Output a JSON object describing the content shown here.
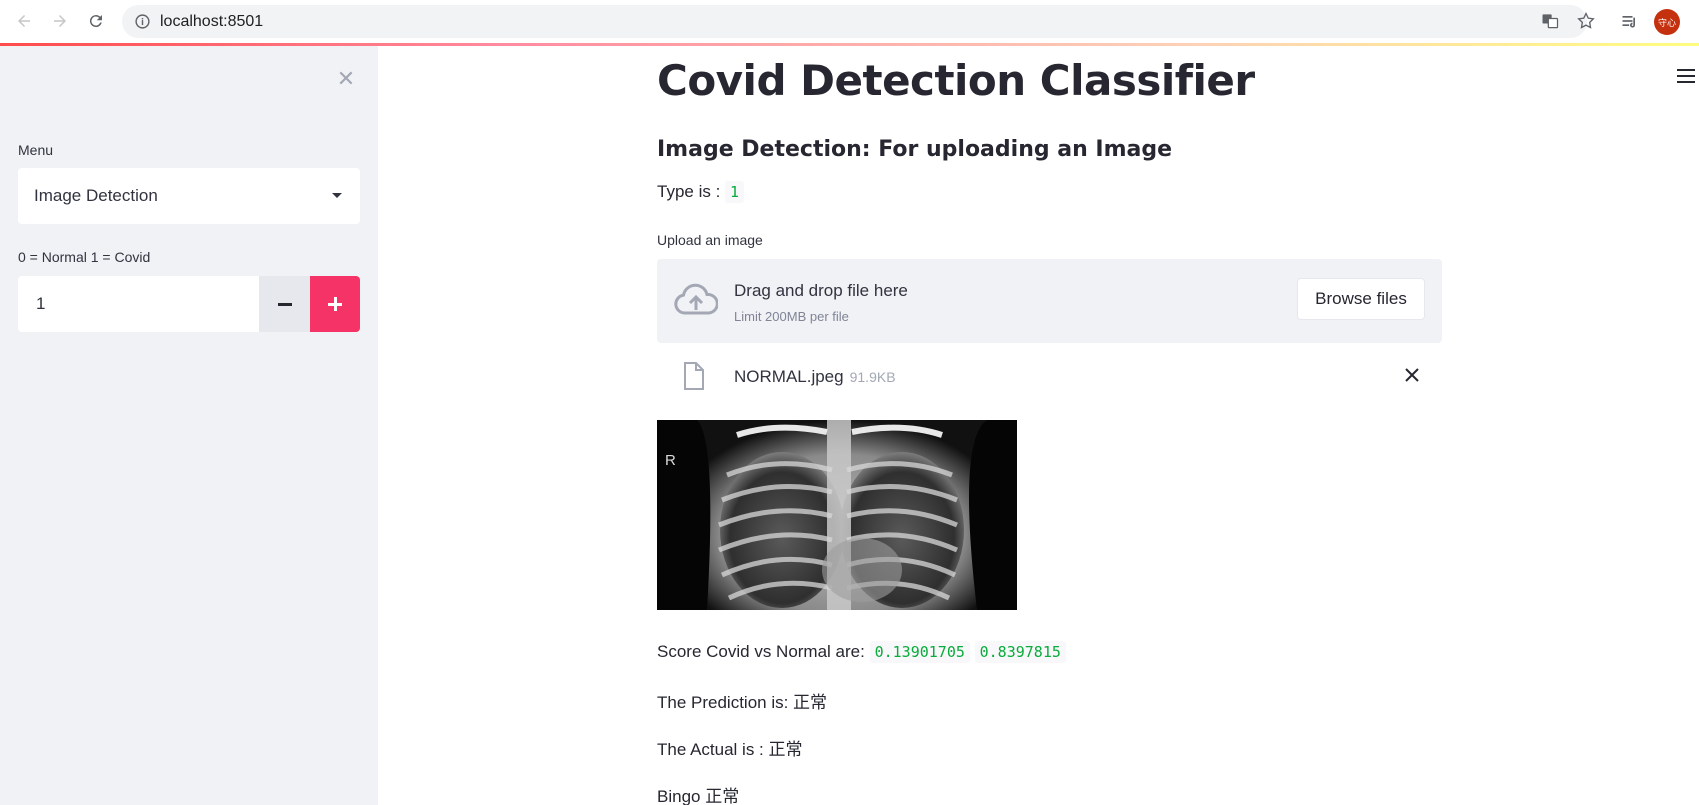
{
  "browser": {
    "url": "localhost:8501",
    "avatar_text": "守心"
  },
  "sidebar": {
    "menu_label": "Menu",
    "menu_selected": "Image Detection",
    "number_label": "0 = Normal 1 = Covid",
    "number_value": "1"
  },
  "main": {
    "title": "Covid Detection Classifier",
    "subheader": "Image Detection: For uploading an Image",
    "type_label": "Type is :",
    "type_value": "1",
    "uploader_label": "Upload an image",
    "dropzone_title": "Drag and drop file here",
    "dropzone_limit": "Limit 200MB per file",
    "browse_label": "Browse files",
    "file_name": "NORMAL.jpeg",
    "file_size": "91.9KB",
    "xray_marker": "R",
    "score_label": "Score Covid vs Normal are:",
    "score_covid": "0.13901705",
    "score_normal": "0.8397815",
    "prediction_label": "The Prediction is: 正常",
    "actual_label": "The Actual is : 正常",
    "bingo_label": "Bingo 正常"
  },
  "colors": {
    "accent": "#f63366",
    "sidebar_bg": "#f0f2f6",
    "code_green": "#09ab3b"
  }
}
